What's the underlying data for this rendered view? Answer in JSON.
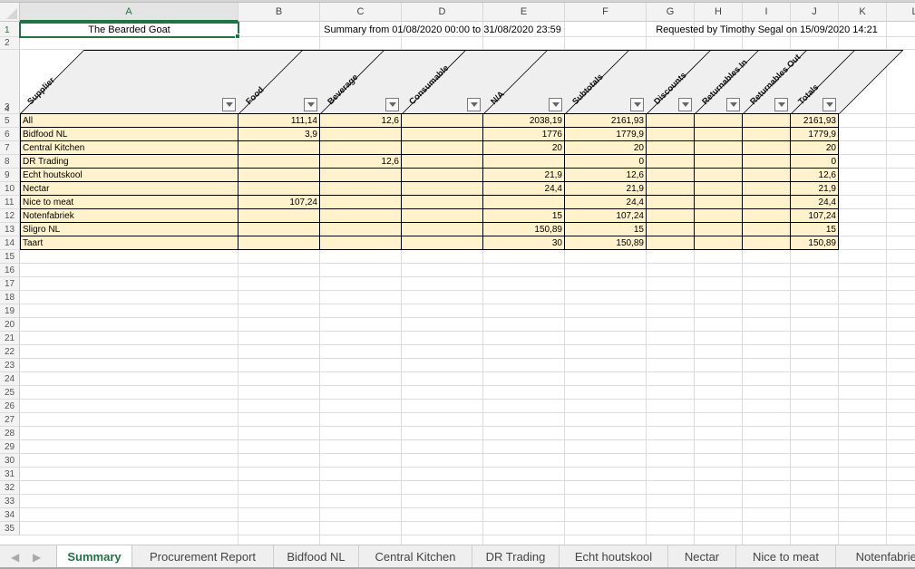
{
  "columns": [
    "A",
    "B",
    "C",
    "D",
    "E",
    "F",
    "G",
    "H",
    "I",
    "J",
    "K",
    "L"
  ],
  "selected_column": "A",
  "selected_row": 1,
  "row_numbers": [
    1,
    2,
    3,
    4,
    5,
    6,
    7,
    8,
    9,
    10,
    11,
    12,
    13,
    14,
    15,
    16,
    17,
    18,
    19,
    20,
    21,
    22,
    23,
    24,
    25,
    26,
    27,
    28,
    29,
    30,
    31,
    32,
    33,
    34,
    35
  ],
  "header_row": {
    "company": "The Bearded Goat",
    "summary": "Summary from 01/08/2020 00:00 to 31/08/2020 23:59",
    "requested": "Requested by Timothy Segal on 15/09/2020 14:21"
  },
  "table": {
    "headers": [
      "Supplier",
      "Food",
      "Beverage",
      "Consumable",
      "N/A",
      "Subtotals",
      "Discounts",
      "Returnables In",
      "Returnables Out",
      "Totals"
    ],
    "rows": [
      [
        "All",
        "111,14",
        "12,6",
        "",
        "2038,19",
        "2161,93",
        "",
        "",
        "",
        "2161,93"
      ],
      [
        "Bidfood NL",
        "3,9",
        "",
        "",
        "1776",
        "1779,9",
        "",
        "",
        "",
        "1779,9"
      ],
      [
        "Central Kitchen",
        "",
        "",
        "",
        "20",
        "20",
        "",
        "",
        "",
        "20"
      ],
      [
        "DR Trading",
        "",
        "12,6",
        "",
        "",
        "0",
        "",
        "",
        "",
        "0"
      ],
      [
        "Echt houtskool",
        "",
        "",
        "",
        "21,9",
        "12,6",
        "",
        "",
        "",
        "12,6"
      ],
      [
        "Nectar",
        "",
        "",
        "",
        "24,4",
        "21,9",
        "",
        "",
        "",
        "21,9"
      ],
      [
        "Nice to meat",
        "107,24",
        "",
        "",
        "",
        "24,4",
        "",
        "",
        "",
        "24,4"
      ],
      [
        "Notenfabriek",
        "",
        "",
        "",
        "15",
        "107,24",
        "",
        "",
        "",
        "107,24"
      ],
      [
        "Sligro NL",
        "",
        "",
        "",
        "150,89",
        "15",
        "",
        "",
        "",
        "15"
      ],
      [
        "Taart",
        "",
        "",
        "",
        "30",
        "150,89",
        "",
        "",
        "",
        "150,89"
      ]
    ]
  },
  "sheet_tabs": [
    "Summary",
    "Procurement Report",
    "Bidfood NL",
    "Central Kitchen",
    "DR Trading",
    "Echt houtskool",
    "Nectar",
    "Nice to meat",
    "Notenfabriek"
  ],
  "active_tab": "Summary",
  "tab_nav": {
    "prev": "◀",
    "next": "▶"
  },
  "colors": {
    "accent": "#217346",
    "table_fill": "#fff2cc",
    "header_fill": "#efefef"
  }
}
